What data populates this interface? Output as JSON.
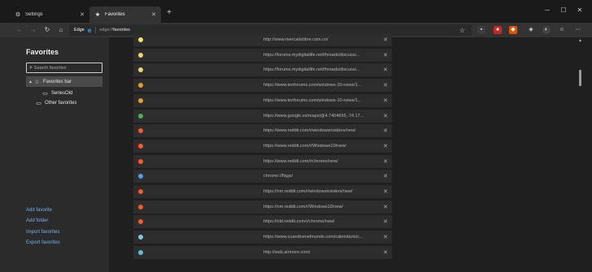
{
  "tabs": [
    {
      "label": "Settings",
      "icon": "gear-icon"
    },
    {
      "label": "Favorites",
      "icon": "star-icon"
    }
  ],
  "toolbar": {
    "site_label": "Edge",
    "url_scheme": "edge://",
    "url_path": "favorites"
  },
  "sidebar": {
    "title": "Favorites",
    "search_placeholder": "Search favorites",
    "tree": [
      {
        "label": "Favorites bar",
        "selected": true
      },
      {
        "label": "SeriesOld"
      },
      {
        "label": "Other favorites"
      }
    ],
    "links": [
      "Add favorite",
      "Add folder",
      "Import favorites",
      "Export favorites"
    ]
  },
  "favorites": [
    {
      "url": "http://www.mercadolibre.com.co/",
      "icon_color": "#f2e36a"
    },
    {
      "url": "https://forums.mydigitallife.net/threads/discussi...",
      "icon_color": "#f2d36a"
    },
    {
      "url": "https://forums.mydigitallife.net/threads/discussi...",
      "icon_color": "#f2d36a"
    },
    {
      "url": "https://www.tenforums.com/windows-10-news/1...",
      "icon_color": "#e0a020"
    },
    {
      "url": "https://www.tenforums.com/windows-10-news/1...",
      "icon_color": "#e0a020"
    },
    {
      "url": "https://www.google.es/maps/@4.7404655,-74.17...",
      "icon_color": "#4caf50"
    },
    {
      "url": "https://www.reddit.com/r/windowsinsiders/new/",
      "icon_color": "#ff5722"
    },
    {
      "url": "https://www.reddit.com/r/Windows10/new/",
      "icon_color": "#ff5722"
    },
    {
      "url": "https://www.reddit.com/r/chrome/new/",
      "icon_color": "#ff5722"
    },
    {
      "url": "chrome://flags/",
      "icon_color": "#4c9fe8"
    },
    {
      "url": "https://nm.reddit.com/r/windowsinsiders/new/",
      "icon_color": "#ff5722"
    },
    {
      "url": "https://nm.reddit.com/r/Windows10/new/",
      "icon_color": "#ff5722"
    },
    {
      "url": "https://old.reddit.com/r/chrome/new/",
      "icon_color": "#ff5722"
    },
    {
      "url": "https://www.cuandoenelmundo.com/calendario/c...",
      "icon_color": "#7ec8e3"
    },
    {
      "url": "http://web.airmore.com/",
      "icon_color": "#5bc0de"
    }
  ]
}
